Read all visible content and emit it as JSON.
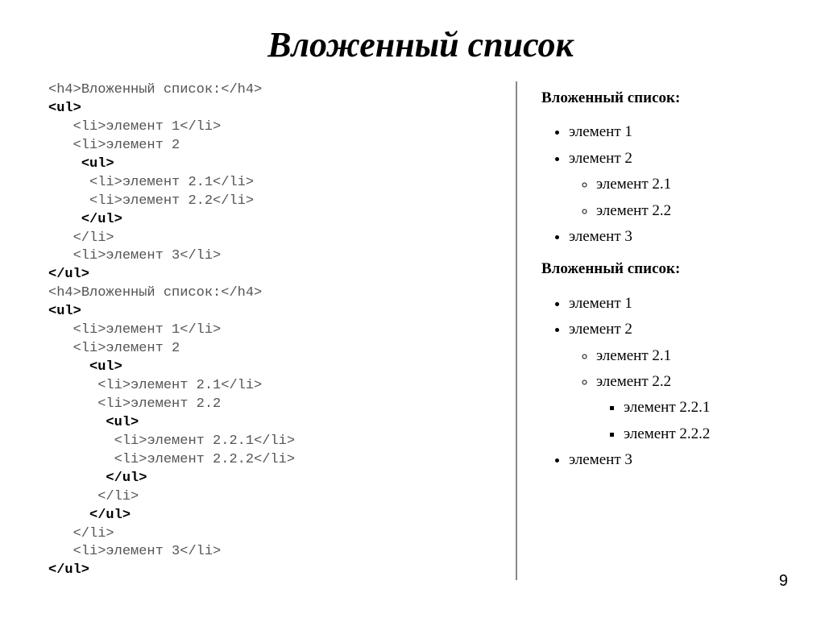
{
  "title": "Вложенный список",
  "pageNumber": "9",
  "code": {
    "h4_open": "<h4>",
    "h4_close": "</h4>",
    "h4_text": "Вложенный список:",
    "ul_open": "<ul>",
    "ul_close": "</ul>",
    "li_open": "<li>",
    "li_close": "</li>",
    "items": {
      "e1": "элемент 1",
      "e2": "элемент 2",
      "e21": "элемент 2.1",
      "e22": "элемент 2.2",
      "e221": "элемент 2.2.1",
      "e222": "элемент 2.2.2",
      "e3": "элемент 3"
    }
  },
  "render": {
    "heading": "Вложенный список:",
    "list1": {
      "i1": "элемент 1",
      "i2": "элемент 2",
      "i21": "элемент 2.1",
      "i22": "элемент 2.2",
      "i3": "элемент 3"
    },
    "list2": {
      "i1": "элемент 1",
      "i2": "элемент 2",
      "i21": "элемент 2.1",
      "i22": "элемент 2.2",
      "i221": "элемент 2.2.1",
      "i222": "элемент 2.2.2",
      "i3": "элемент 3"
    }
  }
}
